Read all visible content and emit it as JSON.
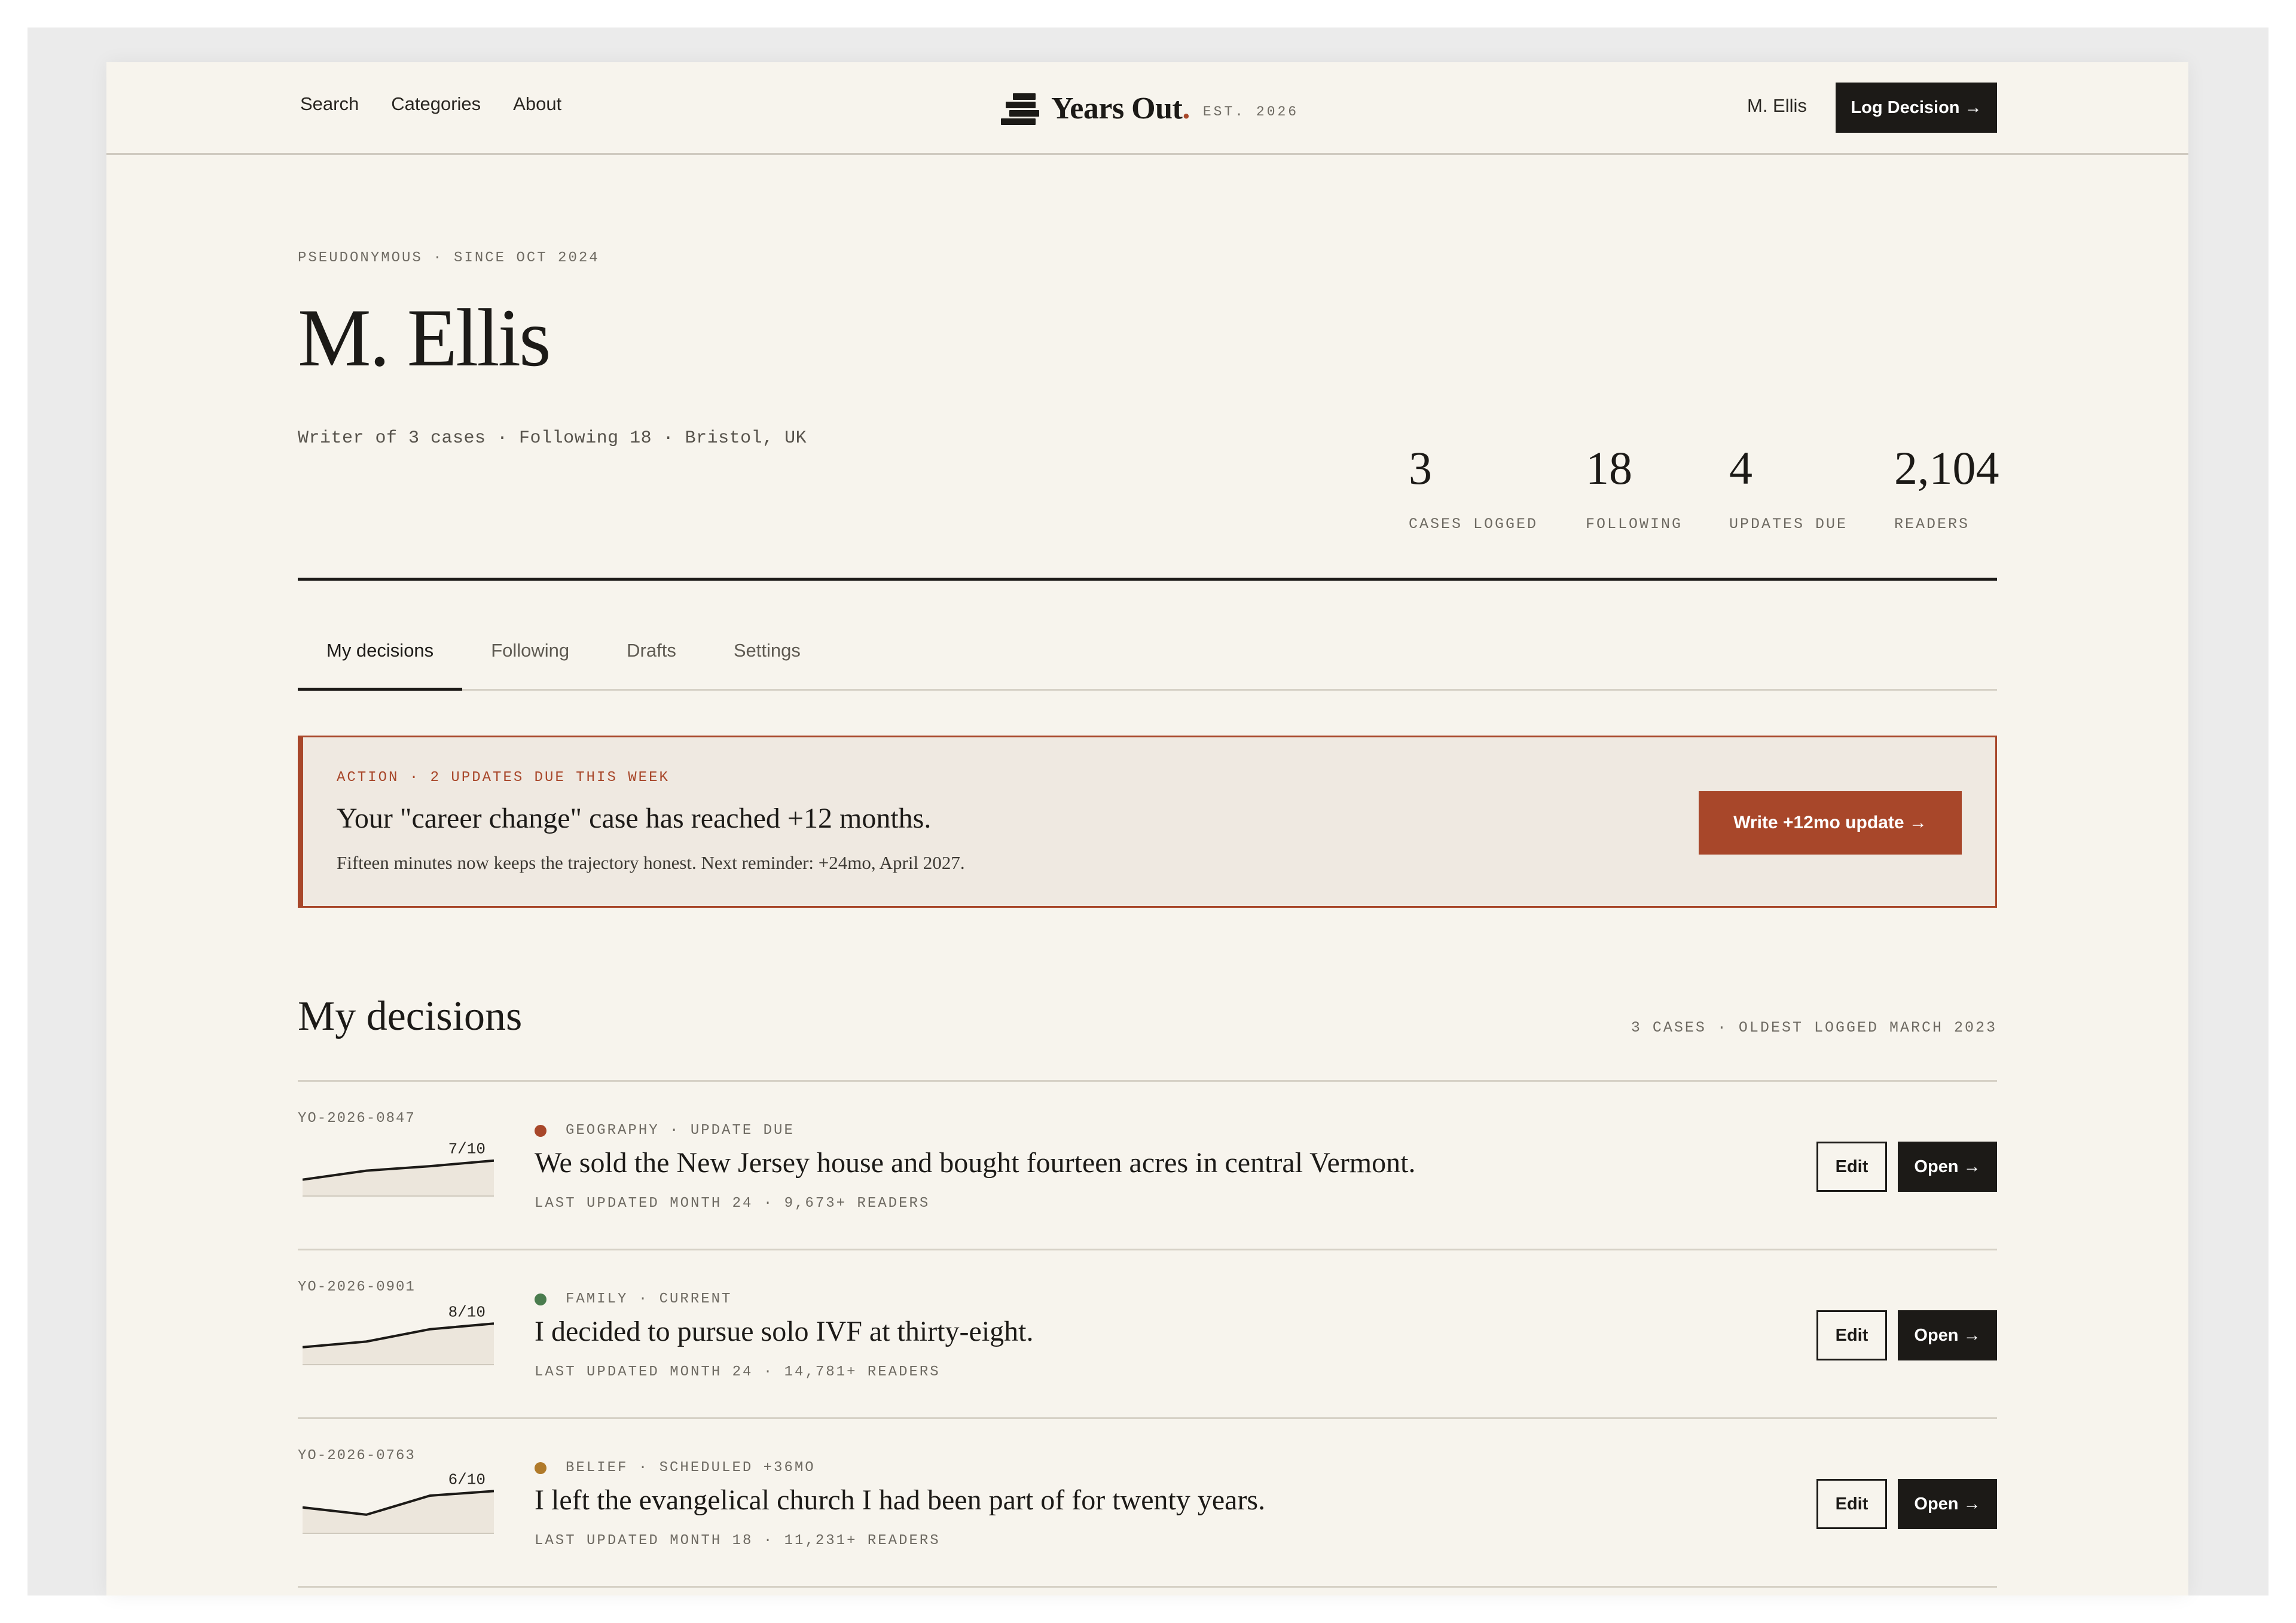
{
  "nav": {
    "links": [
      "Search",
      "Categories",
      "About"
    ],
    "brand_name": "Years Out",
    "brand_dot": ".",
    "brand_est": "EST. 2026",
    "user": "M. Ellis",
    "log_decision": "Log Decision →",
    "brand_icon": "stacked-bars-logo-icon"
  },
  "profile": {
    "kicker": "PSEUDONYMOUS · SINCE OCT 2024",
    "name": "M. Ellis",
    "meta": "Writer of 3 cases · Following 18 · Bristol, UK",
    "stats": [
      {
        "value": "3",
        "label": "CASES LOGGED"
      },
      {
        "value": "18",
        "label": "FOLLOWING"
      },
      {
        "value": "4",
        "label": "UPDATES DUE"
      },
      {
        "value": "2,104",
        "label": "READERS"
      }
    ]
  },
  "tabs": [
    {
      "label": "My decisions",
      "active": true
    },
    {
      "label": "Following",
      "active": false
    },
    {
      "label": "Drafts",
      "active": false
    },
    {
      "label": "Settings",
      "active": false
    }
  ],
  "action": {
    "kicker": "ACTION · 2 UPDATES DUE THIS WEEK",
    "title": "Your \"career change\" case has reached +12 months.",
    "subtitle": "Fifteen minutes now keeps the trajectory honest. Next reminder: +24mo, April 2027.",
    "button": "Write +12mo update →",
    "accent": "#a8472a"
  },
  "decisions": {
    "title": "My decisions",
    "meta": "3 CASES · OLDEST LOGGED MARCH 2023",
    "edit_label": "Edit",
    "open_label": "Open →",
    "items": [
      {
        "id": "YO-2026-0847",
        "category": "GEOGRAPHY · UPDATE DUE",
        "dot_color": "#a8472a",
        "title": "We sold the New Jersey house and bought fourteen acres in central Vermont.",
        "meta": "LAST UPDATED MONTH 24 · 9,673+ READERS",
        "score": "7/10",
        "trend": [
          0.28,
          0.44,
          0.52,
          0.62
        ]
      },
      {
        "id": "YO-2026-0901",
        "category": "FAMILY · CURRENT",
        "dot_color": "#4a7c4e",
        "title": "I decided to pursue solo IVF at thirty-eight.",
        "meta": "LAST UPDATED MONTH 24 · 14,781+ READERS",
        "score": "8/10",
        "trend": [
          0.3,
          0.4,
          0.62,
          0.72
        ]
      },
      {
        "id": "YO-2026-0763",
        "category": "BELIEF · SCHEDULED +36MO",
        "dot_color": "#b07a2a",
        "title": "I left the evangelical church I had been part of for twenty years.",
        "meta": "LAST UPDATED MONTH 18 · 11,231+ READERS",
        "score": "6/10",
        "trend": [
          0.45,
          0.32,
          0.66,
          0.74
        ]
      }
    ]
  }
}
